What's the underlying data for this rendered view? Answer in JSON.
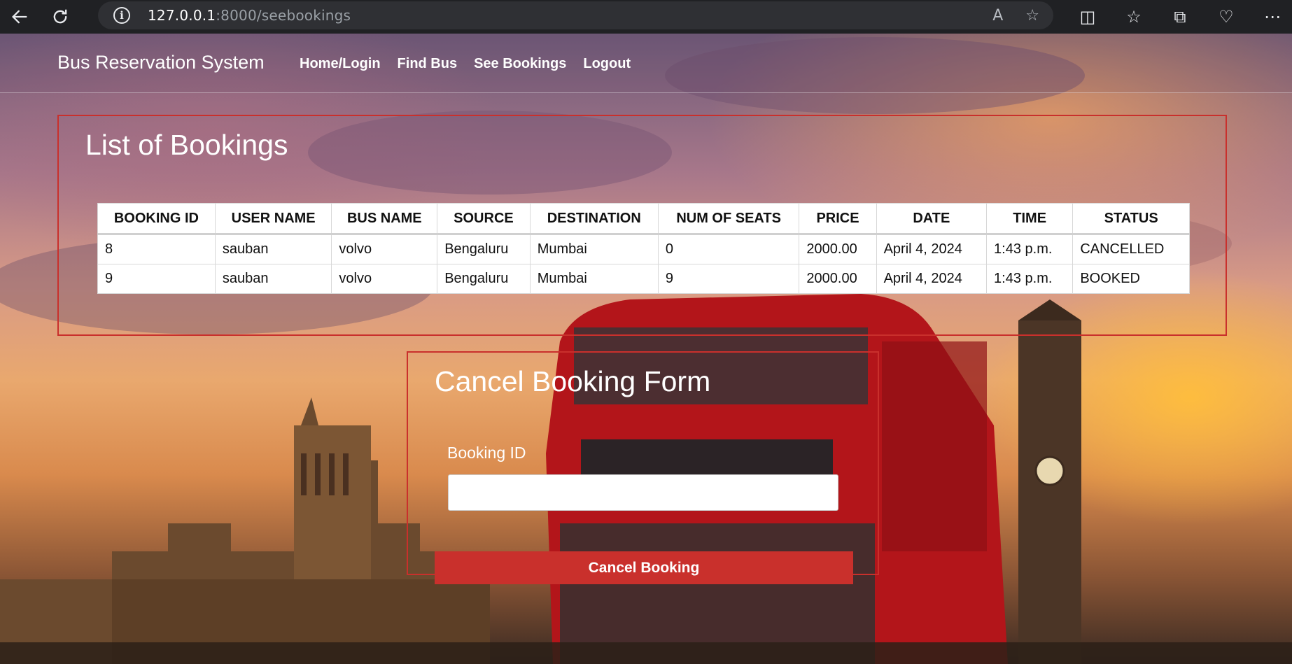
{
  "browser": {
    "url_host": "127.0.0.1",
    "url_path": ":8000/seebookings",
    "icons": [
      "back-icon",
      "reload-icon",
      "site-info-icon",
      "read-aloud-icon",
      "favorite-star-icon",
      "split-screen-icon",
      "favorites-icon",
      "collections-icon",
      "health-icon",
      "more-icon"
    ]
  },
  "navbar": {
    "brand": "Bus Reservation System",
    "links": [
      "Home/Login",
      "Find Bus",
      "See Bookings",
      "Logout"
    ]
  },
  "bookings": {
    "title": "List of Bookings",
    "columns": [
      "BOOKING ID",
      "USER NAME",
      "BUS NAME",
      "SOURCE",
      "DESTINATION",
      "NUM OF SEATS",
      "PRICE",
      "DATE",
      "TIME",
      "STATUS"
    ],
    "rows": [
      [
        "8",
        "sauban",
        "volvo",
        "Bengaluru",
        "Mumbai",
        "0",
        "2000.00",
        "April 4, 2024",
        "1:43 p.m.",
        "CANCELLED"
      ],
      [
        "9",
        "sauban",
        "volvo",
        "Bengaluru",
        "Mumbai",
        "9",
        "2000.00",
        "April 4, 2024",
        "1:43 p.m.",
        "BOOKED"
      ]
    ]
  },
  "cancel_form": {
    "title": "Cancel Booking Form",
    "label": "Booking ID",
    "input_value": "",
    "button": "Cancel Booking"
  },
  "colors": {
    "accent": "#c9302c",
    "chrome": "#202124"
  }
}
